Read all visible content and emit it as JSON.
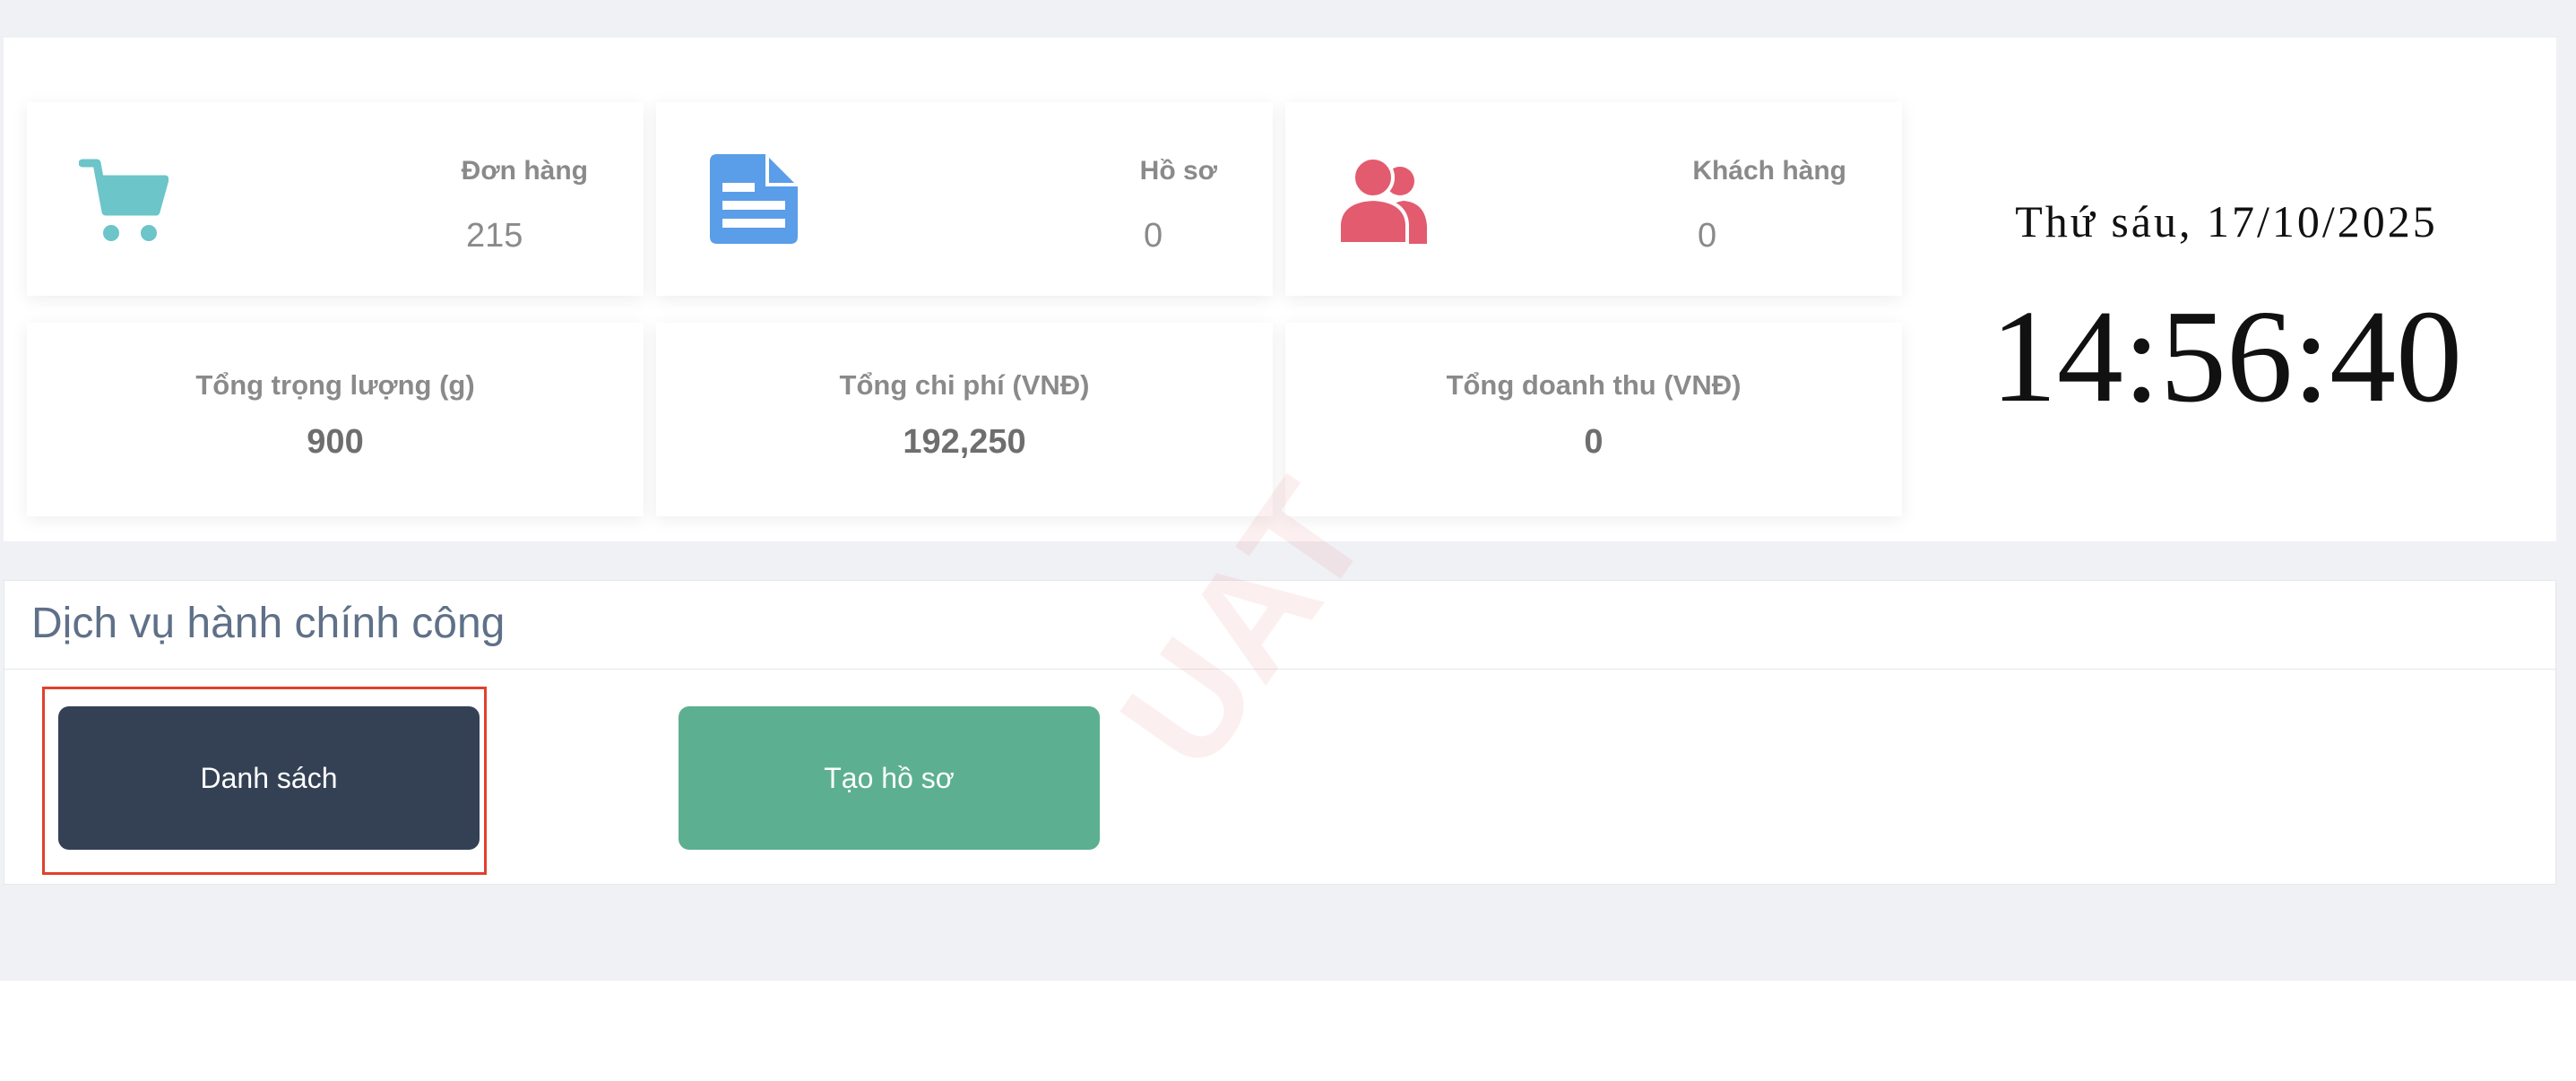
{
  "stats": {
    "orders": {
      "label": "Đơn hàng",
      "value": "215",
      "icon": "shopping-cart-icon",
      "color": "#6cc5c8"
    },
    "files": {
      "label": "Hồ sơ",
      "value": "0",
      "icon": "document-icon",
      "color": "#5a9de8"
    },
    "customers": {
      "label": "Khách hàng",
      "value": "0",
      "icon": "users-icon",
      "color": "#e35b6e"
    }
  },
  "summary": {
    "weight": {
      "label": "Tổng trọng lượng (g)",
      "value": "900"
    },
    "cost": {
      "label": "Tổng chi phí (VNĐ)",
      "value": "192,250"
    },
    "revenue": {
      "label": "Tổng doanh thu (VNĐ)",
      "value": "0"
    }
  },
  "clock": {
    "date": "Thứ sáu, 17/10/2025",
    "time": "14:56:40"
  },
  "services": {
    "title": "Dịch vụ hành chính công",
    "list_button": "Danh sách",
    "create_button": "Tạo hồ sơ"
  },
  "watermark": "UAT"
}
